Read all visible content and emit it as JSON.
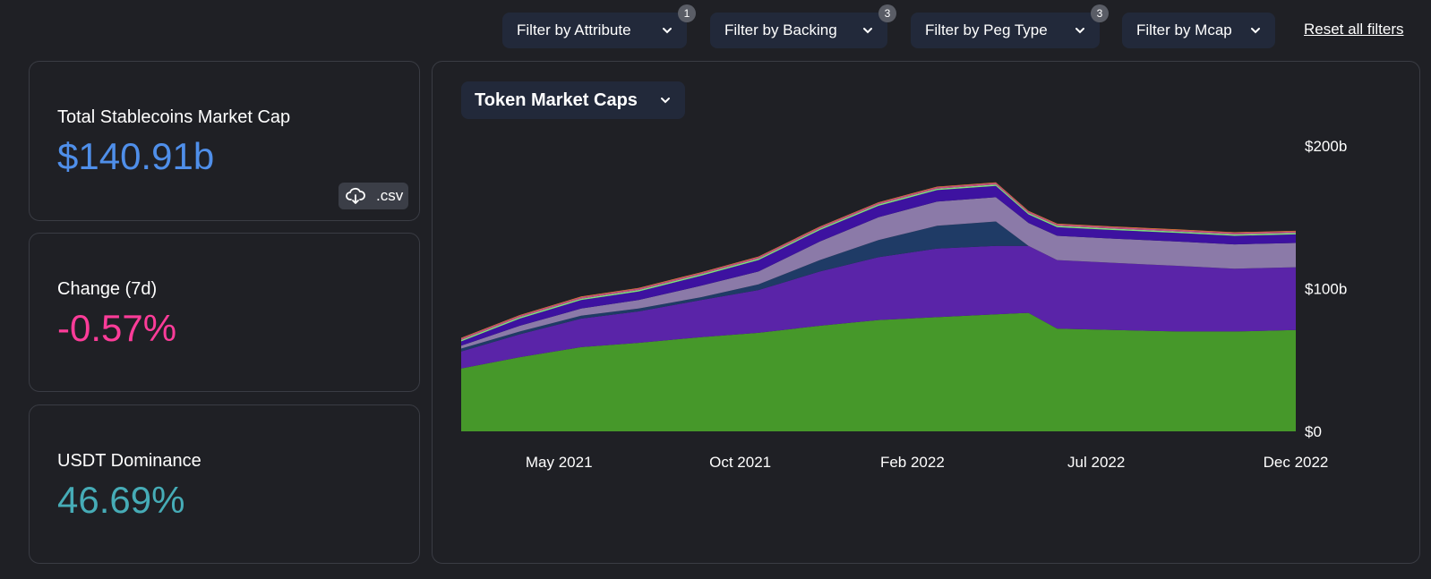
{
  "filters": [
    {
      "label": "Filter by Attribute",
      "badge": "1"
    },
    {
      "label": "Filter by Backing",
      "badge": "3"
    },
    {
      "label": "Filter by Peg Type",
      "badge": "3"
    },
    {
      "label": "Filter by Mcap",
      "badge": ""
    }
  ],
  "reset_label": "Reset all filters",
  "cards": {
    "total": {
      "label": "Total Stablecoins Market Cap",
      "value": "$140.91b",
      "color": "#4f8fea"
    },
    "change": {
      "label": "Change (7d)",
      "value": "-0.57%",
      "color": "#fd3c99"
    },
    "dominance": {
      "label": "USDT Dominance",
      "value": "46.69%",
      "color": "#46acb7"
    }
  },
  "csv_label": ".csv",
  "chart_selector": {
    "label": "Token Market Caps"
  },
  "chart_data": {
    "type": "area",
    "stacked": true,
    "title": "",
    "xlabel": "",
    "ylabel": "",
    "x": [
      "2021-03-01",
      "2021-04-15",
      "2021-06-01",
      "2021-07-15",
      "2021-09-01",
      "2021-10-15",
      "2021-12-01",
      "2022-01-15",
      "2022-03-01",
      "2022-04-15",
      "2022-05-10",
      "2022-06-01",
      "2022-07-15",
      "2022-09-01",
      "2022-10-15",
      "2022-12-01"
    ],
    "x_tick_labels": [
      "May 2021",
      "Oct 2021",
      "Feb 2022",
      "Jul 2022",
      "Dec 2022"
    ],
    "x_tick_positions": [
      "2021-05-15",
      "2021-10-01",
      "2022-02-10",
      "2022-07-01",
      "2022-12-01"
    ],
    "y_ticks": [
      0,
      100,
      200
    ],
    "y_tick_labels": [
      "$0",
      "$100b",
      "$200b"
    ],
    "ylim": [
      0,
      200
    ],
    "y_axis_side": "right",
    "grid": false,
    "series": [
      {
        "color": "#46982a",
        "values": [
          44,
          52,
          59,
          62,
          66,
          69,
          74,
          78,
          80,
          82,
          83,
          72,
          71,
          70,
          70,
          71
        ]
      },
      {
        "color": "#5a24a8",
        "values": [
          12,
          16,
          20,
          22,
          26,
          30,
          38,
          44,
          48,
          48,
          47,
          48,
          47,
          46,
          44,
          44
        ]
      },
      {
        "color": "#1f3b66",
        "values": [
          2,
          2,
          2,
          2,
          2,
          4,
          8,
          12,
          16,
          17,
          0,
          0,
          0,
          0,
          0,
          0
        ]
      },
      {
        "color": "#8b7aa8",
        "values": [
          2,
          4,
          5,
          6,
          8,
          9,
          13,
          16,
          17,
          17,
          16,
          17,
          17,
          17,
          17,
          17
        ]
      },
      {
        "color": "#3d12a0",
        "values": [
          3,
          5,
          6,
          6,
          7,
          8,
          8,
          8,
          8,
          8,
          6,
          6,
          6,
          6,
          6,
          6
        ]
      },
      {
        "color": "#7de07f",
        "values": [
          1,
          1,
          1,
          1,
          1,
          1,
          1,
          1,
          1,
          1,
          1,
          1,
          1,
          1,
          1,
          1
        ]
      },
      {
        "color": "#c44a8a",
        "values": [
          1,
          1,
          1,
          1,
          1,
          1,
          1,
          1,
          1,
          1,
          1,
          1,
          1,
          1,
          1,
          1
        ]
      },
      {
        "color": "#e07a3a",
        "values": [
          0.5,
          0.5,
          0.5,
          0.5,
          0.5,
          0.5,
          0.5,
          0.5,
          0.5,
          0.5,
          0.5,
          0.5,
          0.5,
          0.5,
          0.5,
          0.5
        ]
      }
    ]
  }
}
